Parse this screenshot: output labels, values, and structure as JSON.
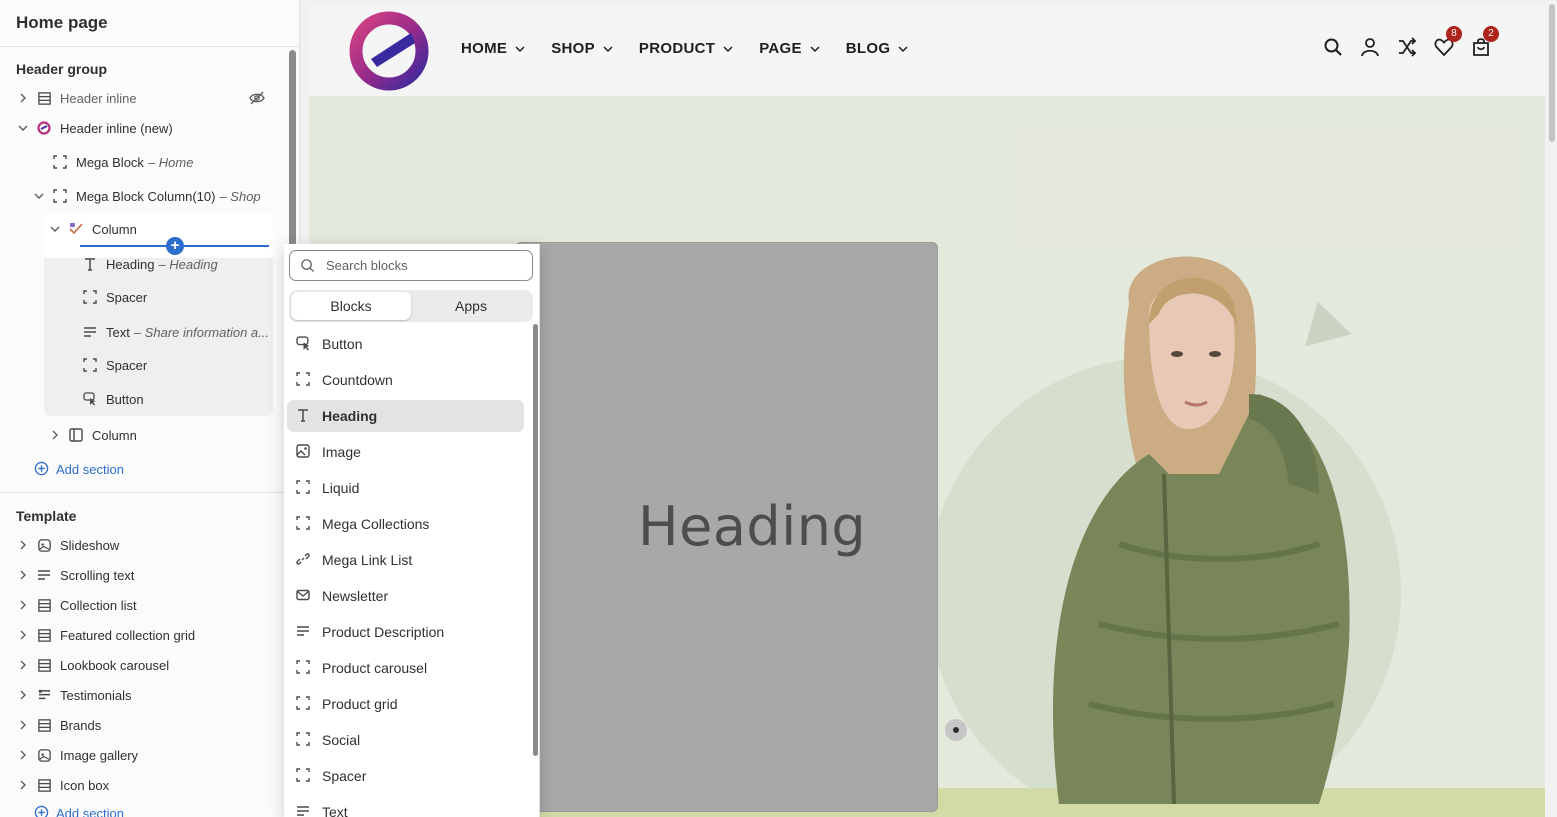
{
  "sidebar": {
    "page_title": "Home page",
    "header_group": {
      "title": "Header group",
      "items": [
        {
          "label": "Header inline",
          "sub": ""
        },
        {
          "label": "Header inline (new)",
          "sub": ""
        },
        {
          "label": "Mega Block",
          "sub": "– Home"
        },
        {
          "label": "Mega Block Column(10)",
          "sub": "– Shop"
        },
        {
          "label": "Column",
          "sub": ""
        },
        {
          "label": "Heading",
          "sub": "– Heading"
        },
        {
          "label": "Spacer",
          "sub": ""
        },
        {
          "label": "Text",
          "sub": "– Share information a..."
        },
        {
          "label": "Spacer",
          "sub": ""
        },
        {
          "label": "Button",
          "sub": ""
        },
        {
          "label": "Column",
          "sub": ""
        }
      ],
      "add_section": "Add section"
    },
    "template": {
      "title": "Template",
      "items": [
        {
          "label": "Slideshow"
        },
        {
          "label": "Scrolling text"
        },
        {
          "label": "Collection list"
        },
        {
          "label": "Featured collection grid"
        },
        {
          "label": "Lookbook carousel"
        },
        {
          "label": "Testimonials"
        },
        {
          "label": "Brands"
        },
        {
          "label": "Image gallery"
        },
        {
          "label": "Icon box"
        }
      ],
      "add_section": "Add section"
    }
  },
  "popover": {
    "search_placeholder": "Search blocks",
    "tabs": [
      "Blocks",
      "Apps"
    ],
    "blocks": [
      {
        "label": "Button",
        "icon": "cursor-icon"
      },
      {
        "label": "Countdown",
        "icon": "block-icon"
      },
      {
        "label": "Heading",
        "icon": "heading-icon"
      },
      {
        "label": "Image",
        "icon": "image-icon"
      },
      {
        "label": "Liquid",
        "icon": "block-icon"
      },
      {
        "label": "Mega Collections",
        "icon": "block-icon"
      },
      {
        "label": "Mega Link List",
        "icon": "link-icon"
      },
      {
        "label": "Newsletter",
        "icon": "mail-icon"
      },
      {
        "label": "Product Description",
        "icon": "text-icon"
      },
      {
        "label": "Product carousel",
        "icon": "block-icon"
      },
      {
        "label": "Product grid",
        "icon": "block-icon"
      },
      {
        "label": "Social",
        "icon": "block-icon"
      },
      {
        "label": "Spacer",
        "icon": "block-icon"
      },
      {
        "label": "Text",
        "icon": "text-icon"
      }
    ]
  },
  "preview": {
    "nav": [
      "HOME",
      "SHOP",
      "PRODUCT",
      "PAGE",
      "BLOG"
    ],
    "wishlist_count": "8",
    "cart_count": "2",
    "block_heading": "Heading"
  },
  "colors": {
    "accent": "#2c6ecb",
    "badge": "#b3261e",
    "hero_bg": "#eef3e7"
  }
}
